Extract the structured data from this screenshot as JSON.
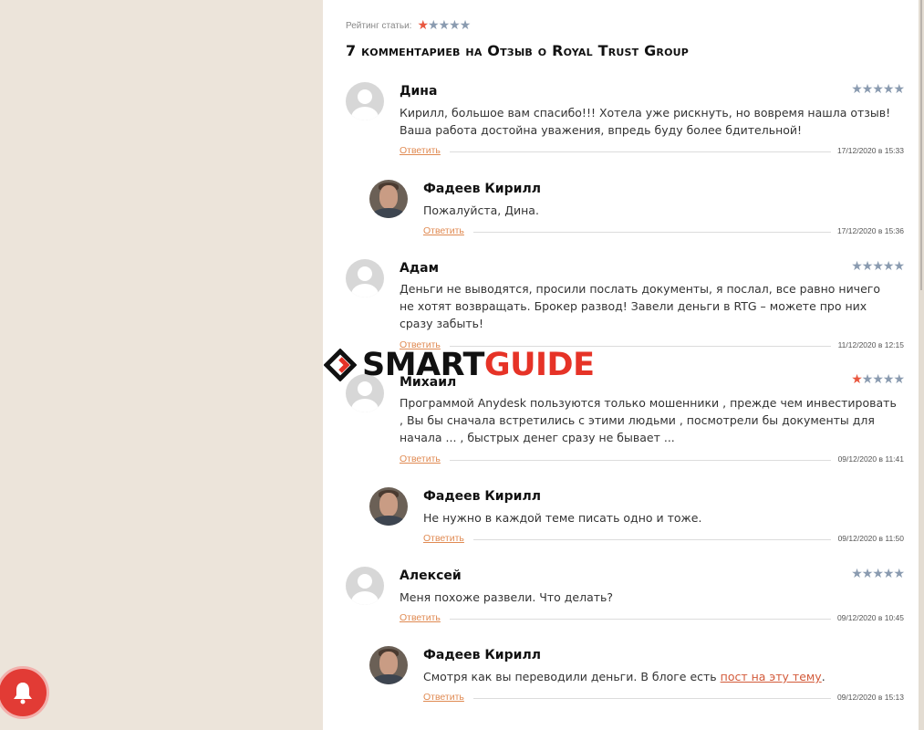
{
  "rating": {
    "label": "Рейтинг статьи:",
    "filled": 1,
    "total": 5
  },
  "heading": "7 комментариев на Отзыв о Royal Trust Group",
  "reply_label": "Ответить",
  "comments": [
    {
      "author": "Дина",
      "stars_filled": 0,
      "text": "Кирилл, большое вам спасибо!!! Хотела уже рискнуть, но вовремя нашла отзыв! Ваша работа достойна уважения, впредь буду более бдительной!",
      "date": "17/12/2020 в 15:33"
    },
    {
      "author": "Фадеев Кирилл",
      "text": "Пожалуйста, Дина.",
      "date": "17/12/2020 в 15:36"
    },
    {
      "author": "Адам",
      "stars_filled": 0,
      "text": "Деньги не выводятся, просили послать документы, я послал, все равно ничего не хотят возвращать. Брокер развод! Завели деньги в RTG – можете про них сразу забыть!",
      "date": "11/12/2020 в 12:15"
    },
    {
      "author": "Михаил",
      "stars_filled": 1,
      "text": "Программой Anydesk пользуются только мошенники , прежде чем инвестировать , Вы бы сначала встретились с этими людьми , посмотрели бы документы для начала ... , быстрых денег сразу не бывает ...",
      "date": "09/12/2020 в 11:41"
    },
    {
      "author": "Фадеев Кирилл",
      "text": "Не нужно в каждой теме писать одно и тоже.",
      "date": "09/12/2020 в 11:50"
    },
    {
      "author": "Алексей",
      "stars_filled": 0,
      "text": "Меня похоже развели. Что делать?",
      "date": "09/12/2020 в 10:45"
    },
    {
      "author": "Фадеев Кирилл",
      "text_before": "Смотря как вы переводили деньги. В блоге есть ",
      "link": "пост на эту тему",
      "text_after": ".",
      "date": "09/12/2020 в 15:13"
    }
  ],
  "watermark": {
    "word1": "SMART",
    "word2": "GUIDE"
  },
  "colors": {
    "accent": "#e08a52",
    "star_filled": "#e9573f",
    "star_empty": "#8a9bb0",
    "brand_red": "#e63327",
    "page_bg": "#ece4da"
  },
  "icons": {
    "notification": "bell-icon",
    "avatar_default": "user-placeholder-icon"
  }
}
